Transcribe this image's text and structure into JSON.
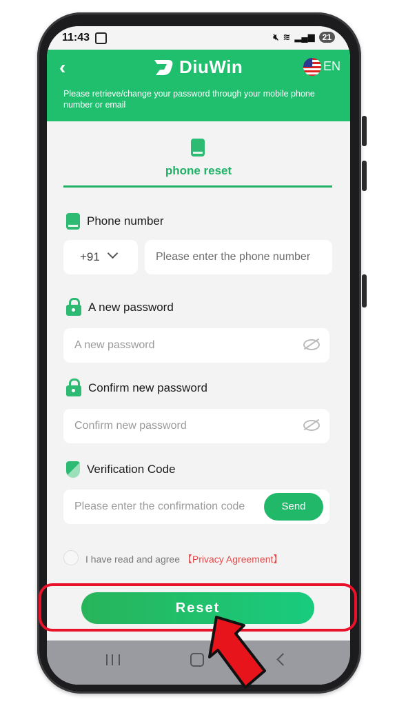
{
  "status_bar": {
    "time": "11:43",
    "battery": "21"
  },
  "header": {
    "back_icon": "chevron-left-icon",
    "brand": "DiuWin",
    "language": "EN",
    "subtitle": "Please retrieve/change your password through your mobile phone number or email"
  },
  "tab": {
    "label": "phone reset",
    "icon": "phone-icon"
  },
  "form": {
    "phone_label": "Phone number",
    "country_code": "+91",
    "phone_placeholder": "Please enter the phone number",
    "new_password_label": "A new password",
    "new_password_placeholder": "A new password",
    "confirm_label": "Confirm new password",
    "confirm_placeholder": "Confirm new password",
    "code_label": "Verification Code",
    "code_placeholder": "Please enter the confirmation code",
    "send_label": "Send",
    "agree_text": "I have read and agree",
    "agree_link": "【Privacy Agreement】",
    "reset_label": "Reset"
  },
  "colors": {
    "brand_green": "#1fbf6e",
    "highlight_red": "#e8132a",
    "link_red": "#e24a4a"
  }
}
